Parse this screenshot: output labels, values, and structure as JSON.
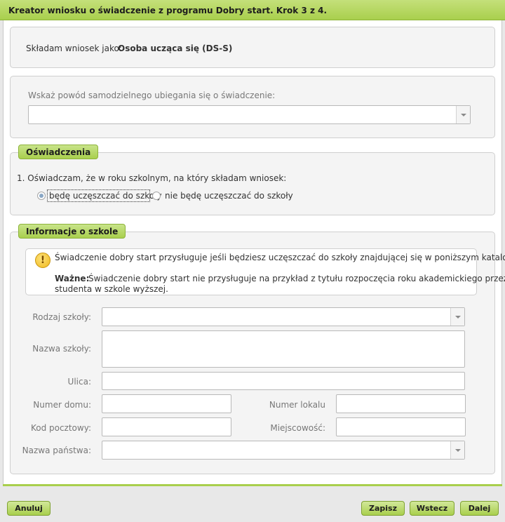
{
  "window": {
    "title": "Kreator wniosku o świadczenie z programu Dobry start. Krok 3 z 4."
  },
  "applicant": {
    "label": "Składam wniosek jako:",
    "value": "Osoba ucząca się (DS-S)"
  },
  "reason": {
    "label": "Wskaż powód samodzielnego ubiegania się o świadczenie:",
    "value": ""
  },
  "declarations": {
    "legend": "Oświadczenia",
    "statement": "1. Oświadczam, że w roku szkolnym, na który składam wniosek:",
    "options": [
      {
        "label": "będę uczęszczać do szkoły",
        "checked": true
      },
      {
        "label": "nie będę uczęszczać do szkoły",
        "checked": false
      }
    ]
  },
  "school": {
    "legend": "Informacje o szkole",
    "info_line1": "Świadczenie dobry start przysługuje jeśli będziesz uczęszczać do szkoły znajdującej się w poniższym katalogu.",
    "info_bold": "Ważne:",
    "info_line2": "Świadczenie dobry start nie przysługuje na przykład z tytułu rozpoczęcia roku akademickiego przez",
    "info_line3": "studenta w szkole wyższej.",
    "fields": {
      "type_label": "Rodzaj szkoły:",
      "name_label": "Nazwa szkoły:",
      "street_label": "Ulica:",
      "house_label": "Numer domu:",
      "flat_label": "Numer lokalu",
      "postal_label": "Kod pocztowy:",
      "city_label": "Miejscowość:",
      "country_label": "Nazwa państwa:"
    }
  },
  "buttons": {
    "cancel": "Anuluj",
    "save": "Zapisz",
    "back": "Wstecz",
    "next": "Dalej"
  }
}
